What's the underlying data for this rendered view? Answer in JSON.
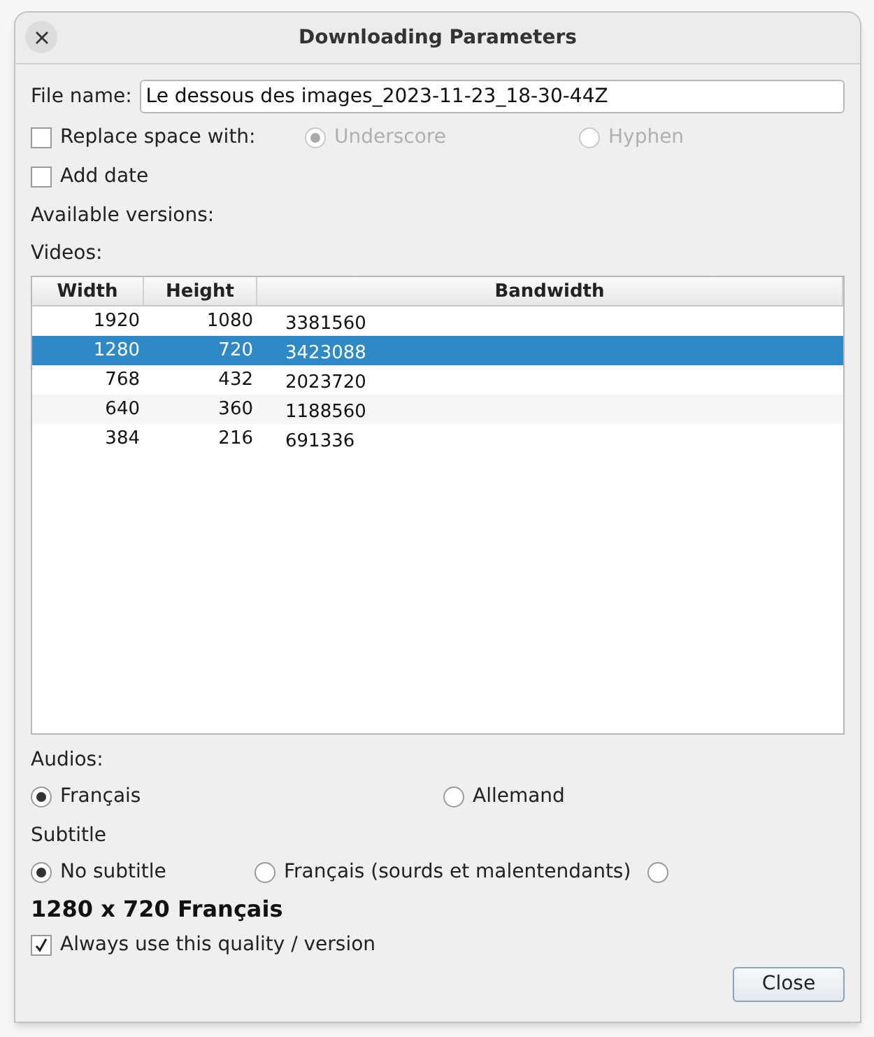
{
  "window": {
    "title": "Downloading Parameters"
  },
  "file_name": {
    "label": "File name:",
    "value": "Le dessous des images_2023-11-23_18-30-44Z"
  },
  "replace_space": {
    "label": "Replace space with:",
    "checked": false,
    "options": [
      {
        "label": "Underscore",
        "selected": true,
        "disabled": true
      },
      {
        "label": "Hyphen",
        "selected": false,
        "disabled": true
      }
    ]
  },
  "add_date": {
    "label": "Add date",
    "checked": false
  },
  "available_versions_label": "Available versions:",
  "videos": {
    "label": "Videos:",
    "columns": [
      "Width",
      "Height",
      "Bandwidth"
    ],
    "rows": [
      {
        "cells": [
          "1920",
          "1080",
          "3381560"
        ],
        "selected": false
      },
      {
        "cells": [
          "1280",
          "720",
          "3423088"
        ],
        "selected": true
      },
      {
        "cells": [
          "768",
          "432",
          "2023720"
        ],
        "selected": false
      },
      {
        "cells": [
          "640",
          "360",
          "1188560"
        ],
        "selected": false
      },
      {
        "cells": [
          "384",
          "216",
          "691336"
        ],
        "selected": false
      }
    ]
  },
  "audios": {
    "label": "Audios:",
    "options": [
      {
        "label": "Français",
        "selected": true
      },
      {
        "label": "Allemand",
        "selected": false
      }
    ]
  },
  "subtitle": {
    "label": "Subtitle",
    "options": [
      {
        "label": "No subtitle",
        "selected": true
      },
      {
        "label": "Français (sourds et malentendants)",
        "selected": false
      },
      {
        "selected": false
      }
    ]
  },
  "summary": "1280 x 720 Français",
  "always_use": {
    "label": "Always use this quality / version",
    "checked": true
  },
  "buttons": [
    "Close"
  ]
}
